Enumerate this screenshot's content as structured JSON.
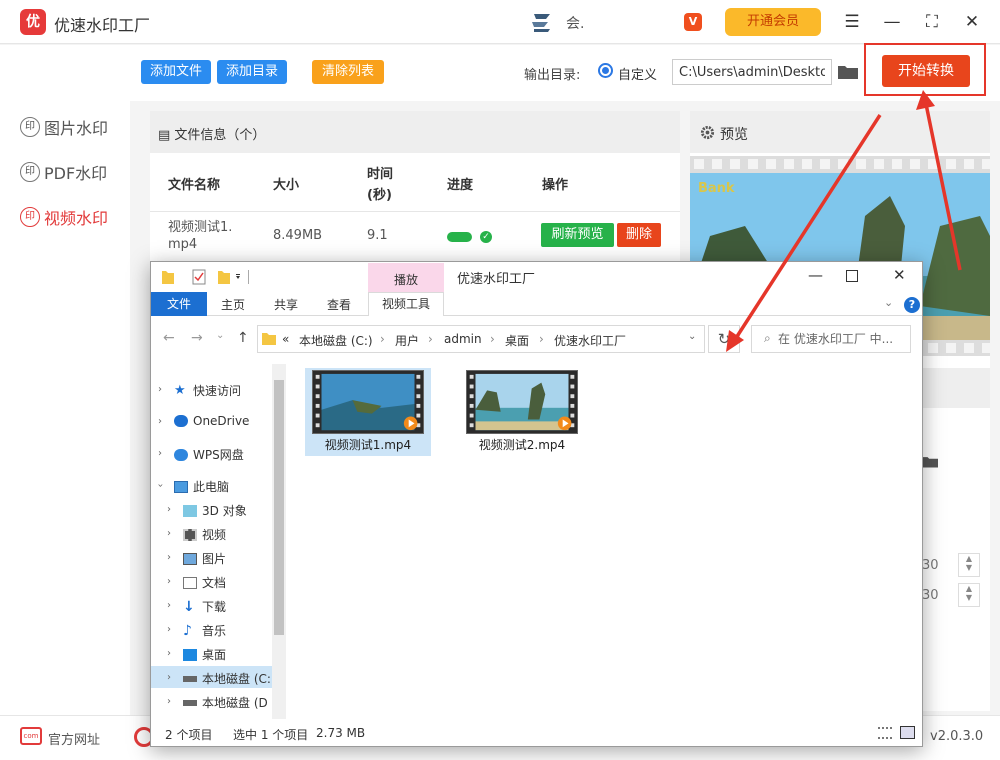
{
  "app": {
    "title": "优速水印工厂",
    "logo_text": "优",
    "user_name": "会.",
    "vip_label": "开通会员"
  },
  "window_controls": {
    "menu": "☰",
    "minimize": "—",
    "maximize": "⛶",
    "close": "✕"
  },
  "nav": {
    "items": [
      {
        "icon": "印",
        "label": "图片水印"
      },
      {
        "icon": "印",
        "label": "PDF水印"
      },
      {
        "icon": "印",
        "label": "视频水印"
      }
    ],
    "active_index": 2
  },
  "toolbar": {
    "add_file": "添加文件",
    "add_dir": "添加目录",
    "clear_list": "清除列表",
    "output_label": "输出目录:",
    "radio_label": "自定义",
    "output_path": "C:\\Users\\admin\\Deskto",
    "start": "开始转换"
  },
  "file_list": {
    "title": "文件信息（个）",
    "columns": [
      "文件名称",
      "大小",
      "时间",
      "(秒)",
      "进度",
      "操作"
    ],
    "rows": [
      {
        "name_line1": "视频测试1.",
        "name_line2": "mp4",
        "size": "8.49MB",
        "duration": "9.1",
        "progress": 1.0,
        "refresh": "刷新预览",
        "delete": "删除"
      }
    ]
  },
  "preview": {
    "title": "预览",
    "watermark_text": "Bank",
    "spin_values": [
      "30",
      "30"
    ]
  },
  "bottom": {
    "site_icon": "com",
    "site_link": "官方网址",
    "version": "v2.0.3.0"
  },
  "explorer": {
    "title": "优速水印工厂",
    "context_tab": "播放",
    "tabs": [
      "文件",
      "主页",
      "共享",
      "查看",
      "视频工具"
    ],
    "breadcrumb": [
      "«",
      "本地磁盘 (C:)",
      "›",
      "用户",
      "›",
      "admin",
      "›",
      "桌面",
      "›",
      "优速水印工厂"
    ],
    "search_placeholder": "在 优速水印工厂 中...",
    "tree": [
      {
        "label": "快速访问",
        "icon": "star-icon"
      },
      {
        "label": "OneDrive",
        "icon": "cloud-icon"
      },
      {
        "label": "WPS网盘",
        "icon": "cloud-icon"
      },
      {
        "label": "此电脑",
        "icon": "computer-icon"
      },
      {
        "label": "3D 对象",
        "icon": "cube-icon"
      },
      {
        "label": "视频",
        "icon": "video-icon"
      },
      {
        "label": "图片",
        "icon": "picture-icon"
      },
      {
        "label": "文档",
        "icon": "document-icon"
      },
      {
        "label": "下载",
        "icon": "download-icon"
      },
      {
        "label": "音乐",
        "icon": "music-icon"
      },
      {
        "label": "桌面",
        "icon": "desktop-icon"
      },
      {
        "label": "本地磁盘 (C:",
        "icon": "drive-icon"
      },
      {
        "label": "本地磁盘 (D",
        "icon": "drive-icon"
      }
    ],
    "files": [
      {
        "name": "视频测试1.mp4"
      },
      {
        "name": "视频测试2.mp4"
      }
    ],
    "status": {
      "count": "2 个项目",
      "selected": "选中 1 个项目",
      "size": "2.73 MB"
    }
  },
  "colors": {
    "accent_blue": "#2b8cf0",
    "start_red": "#e8451c",
    "green": "#27b24a",
    "clear_orange": "#f9a11b",
    "arrow_red": "#e5362a"
  }
}
